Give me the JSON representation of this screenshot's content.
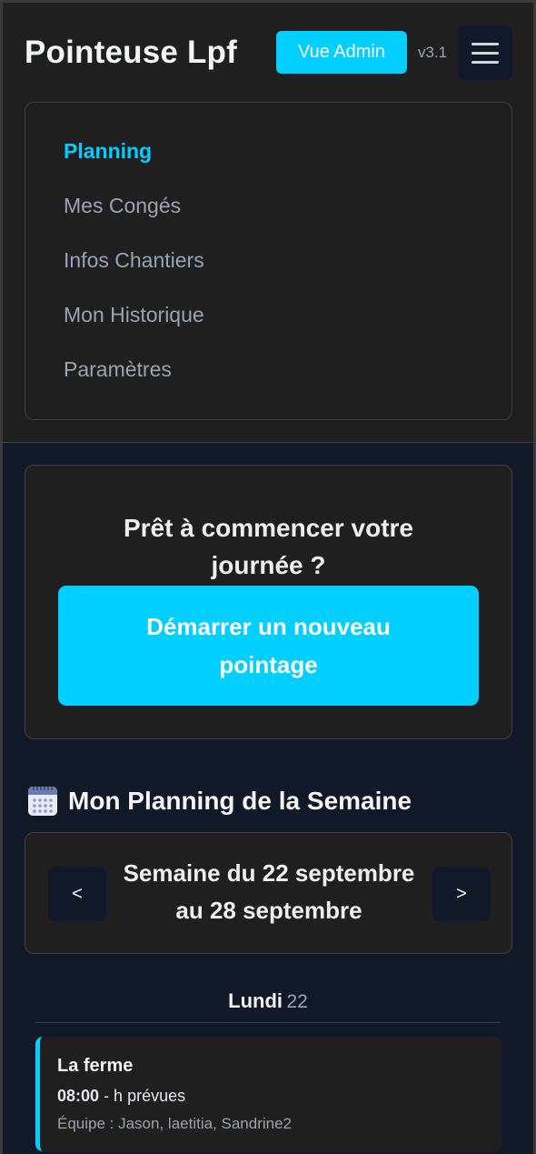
{
  "header": {
    "title": "Pointeuse Lpf",
    "admin_button": "Vue Admin",
    "version": "v3.1",
    "menu_icon": "hamburger-icon"
  },
  "nav": {
    "items": [
      {
        "label": "Planning",
        "active": true
      },
      {
        "label": "Mes Congés",
        "active": false
      },
      {
        "label": "Infos Chantiers",
        "active": false
      },
      {
        "label": "Mon Historique",
        "active": false
      },
      {
        "label": "Paramètres",
        "active": false
      }
    ]
  },
  "start": {
    "prompt": "Prêt à commencer votre journée ?",
    "button": "Démarrer un nouveau pointage"
  },
  "planning": {
    "icon": "calendar-icon",
    "title": "Mon Planning de la Semaine",
    "prev_label": "<",
    "next_label": ">",
    "week_label": "Semaine du 22 septembre au 28 septembre"
  },
  "day": {
    "name": "Lundi",
    "number": "22"
  },
  "shift": {
    "site": "La ferme",
    "start_time": "08:00",
    "hours_text": "- h prévues",
    "team": "Équipe : Jason, laetitia, Sandrine2"
  },
  "colors": {
    "accent": "#00cfff",
    "background": "#111827",
    "surface": "#1f1f1f"
  }
}
